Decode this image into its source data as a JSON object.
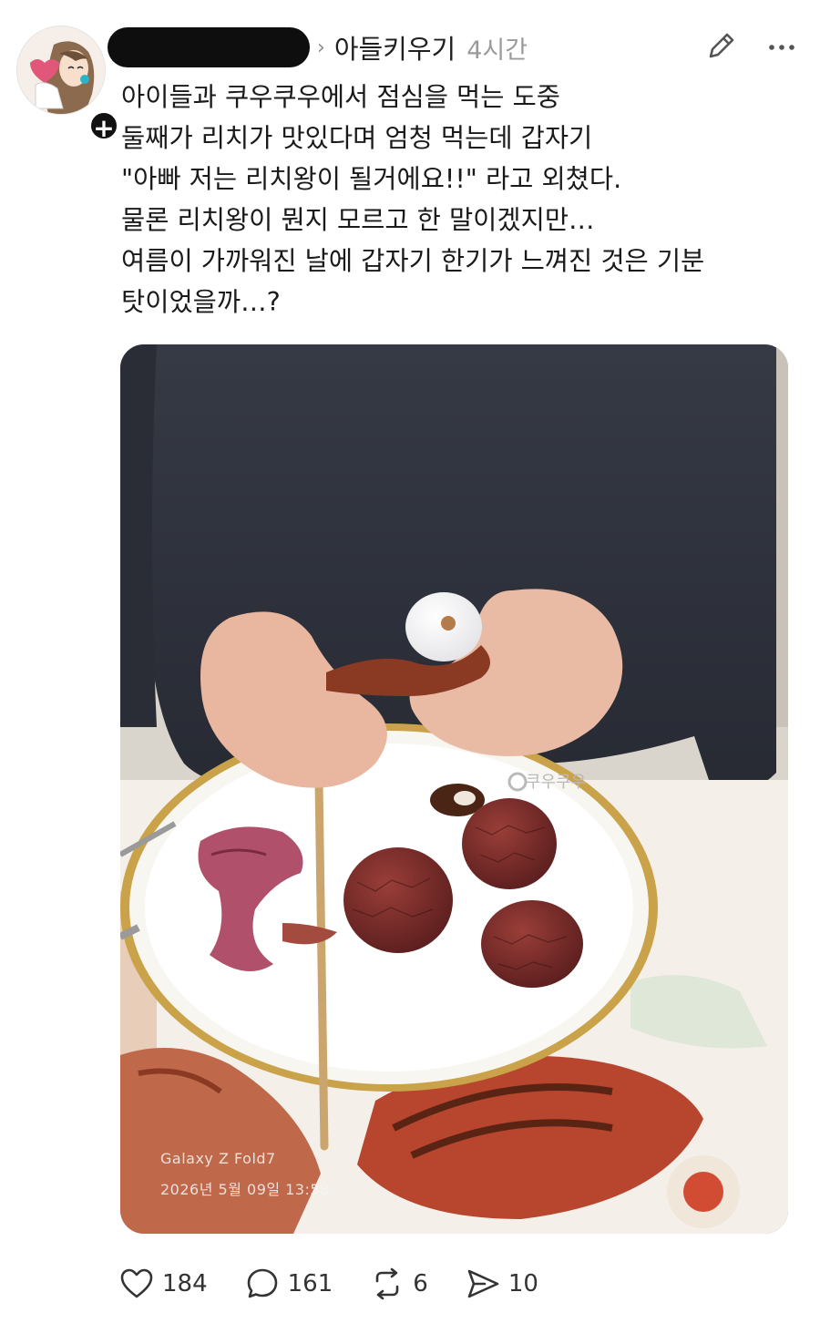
{
  "header": {
    "topic": "아들키우기",
    "time": "4시간",
    "chevron": "›"
  },
  "icons": {
    "edit": "pencil-icon",
    "more": "more-horizontal-icon",
    "follow": "plus-icon",
    "like": "heart-icon",
    "reply": "reply-bubble-icon",
    "repost": "repost-icon",
    "share": "share-send-icon"
  },
  "post": {
    "lines": [
      "아이들과 쿠우쿠우에서 점심을 먹는 도중",
      "둘째가 리치가 맛있다며 엄청 먹는데 갑자기",
      "\"아빠 저는 리치왕이 될거에요!!\" 라고 외쳤다.",
      "물론 리치왕이 뭔지 모르고 한 말이겠지만…",
      "여름이 가까워진 날에 갑자기 한기가 느껴진 것은 기분",
      "탓이었을까…?"
    ]
  },
  "photo": {
    "plate_logo": "쿠우쿠우",
    "watermark_device": "Galaxy Z Fold7",
    "watermark_datetime": "2026년 5월 09일 13:58"
  },
  "actions": {
    "likes": "184",
    "replies": "161",
    "reposts": "6",
    "shares": "10"
  },
  "colors": {
    "redaction": "#0e0e0e",
    "muted_text": "#9a9a9a",
    "plate_rim": "#c9a24a",
    "lychee": "#7a2c2a"
  }
}
